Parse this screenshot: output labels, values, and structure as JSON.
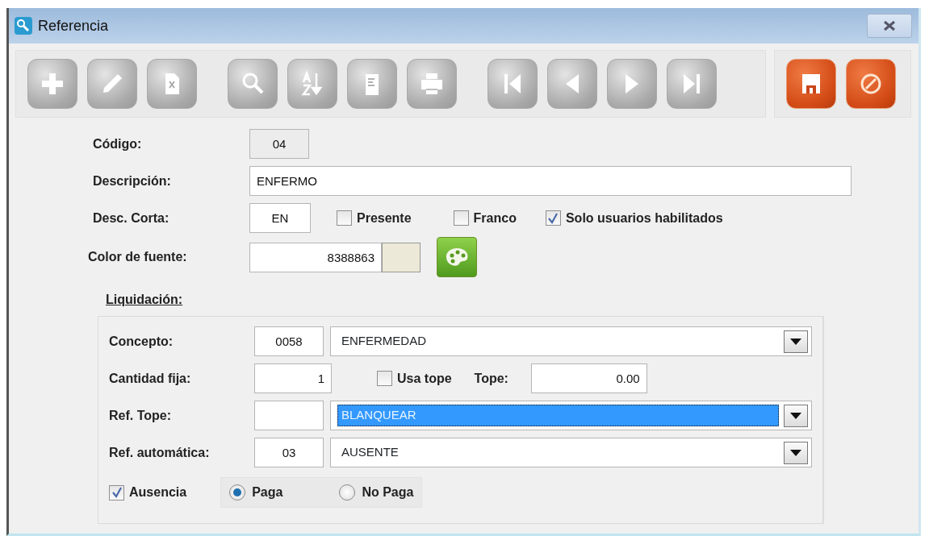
{
  "window": {
    "title": "Referencia"
  },
  "toolbar": {
    "groups": [
      {
        "buttons": [
          {
            "kind": "add",
            "disabled": true
          },
          {
            "kind": "edit",
            "disabled": true
          },
          {
            "kind": "delete",
            "disabled": true
          }
        ]
      },
      {
        "buttons": [
          {
            "kind": "search",
            "disabled": true
          },
          {
            "kind": "sort",
            "disabled": true
          },
          {
            "kind": "report",
            "disabled": true
          },
          {
            "kind": "print",
            "disabled": true
          }
        ]
      },
      {
        "buttons": [
          {
            "kind": "first",
            "disabled": true
          },
          {
            "kind": "previous",
            "disabled": true
          },
          {
            "kind": "next",
            "disabled": true
          },
          {
            "kind": "last",
            "disabled": true
          }
        ]
      }
    ],
    "actions": [
      {
        "kind": "save",
        "disabled": false
      },
      {
        "kind": "cancel",
        "disabled": false
      }
    ]
  },
  "form": {
    "codigo": {
      "label": "Código:",
      "value": "04",
      "readonly": true
    },
    "descripcion": {
      "label": "Descripción:",
      "value": "ENFERMO"
    },
    "desc_corta": {
      "label": "Desc. Corta:",
      "value": "EN"
    },
    "flags": [
      {
        "label": "Presente",
        "checked": false
      },
      {
        "label": "Franco",
        "checked": false
      },
      {
        "label": "Solo usuarios habilitados",
        "checked": true
      }
    ],
    "color_fuente": {
      "label": "Color de fuente:",
      "value": "8388863",
      "color": "#ece9d8"
    }
  },
  "liquidacion": {
    "title": "Liquidación:",
    "concepto": {
      "label": "Concepto:",
      "code": "0058",
      "value": "ENFERMEDAD",
      "selected": false
    },
    "cantidad_fija": {
      "label": "Cantidad fija:",
      "value": "1"
    },
    "usa_tope": {
      "label": "Usa tope",
      "checked": false
    },
    "tope": {
      "label": "Tope:",
      "value": "0.00"
    },
    "ref_tope": {
      "label": "Ref. Tope:",
      "value": "BLANQUEAR",
      "selected": true
    },
    "ref_automatica": {
      "label": "Ref. automática:",
      "code": "03",
      "value": "AUSENTE",
      "selected": false
    },
    "ausencia": {
      "label": "Ausencia",
      "checked": true
    },
    "pago": [
      {
        "label": "Paga",
        "selected": true
      },
      {
        "label": "No Paga",
        "selected": false
      }
    ]
  }
}
